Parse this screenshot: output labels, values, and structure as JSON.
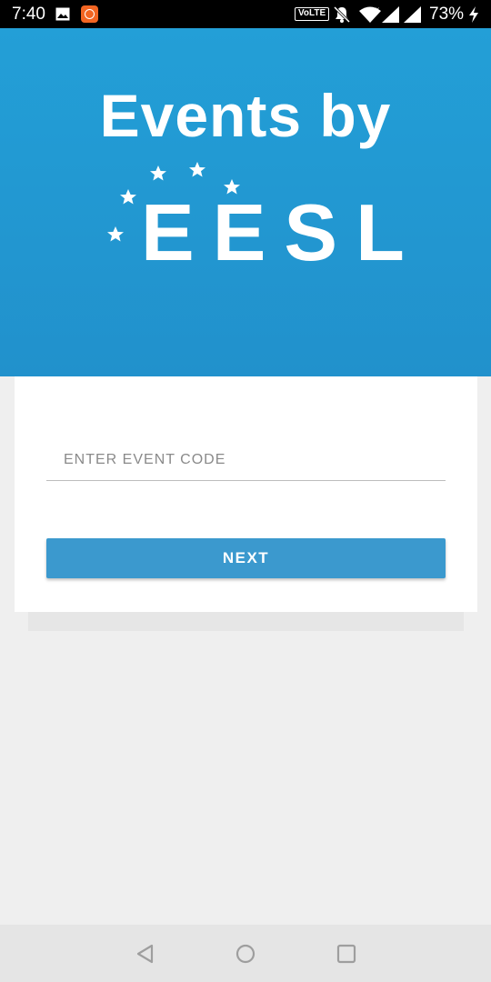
{
  "status_bar": {
    "time": "7:40",
    "volte": "VoLTE",
    "battery": "73%",
    "icons": [
      "gallery-icon",
      "app-notification-icon",
      "volte-icon",
      "bell-off-icon",
      "wifi-icon",
      "signal-icon",
      "signal-icon",
      "charging-icon"
    ]
  },
  "header": {
    "logo_line1": "Events by",
    "logo_line2": "EESL",
    "background_color": "#239fd7"
  },
  "form": {
    "event_code_placeholder": "ENTER EVENT CODE",
    "event_code_value": "",
    "next_label": "NEXT",
    "button_color": "#3b99ce"
  },
  "nav_bar": {
    "icons": [
      "back-icon",
      "home-icon",
      "recent-apps-icon"
    ]
  }
}
